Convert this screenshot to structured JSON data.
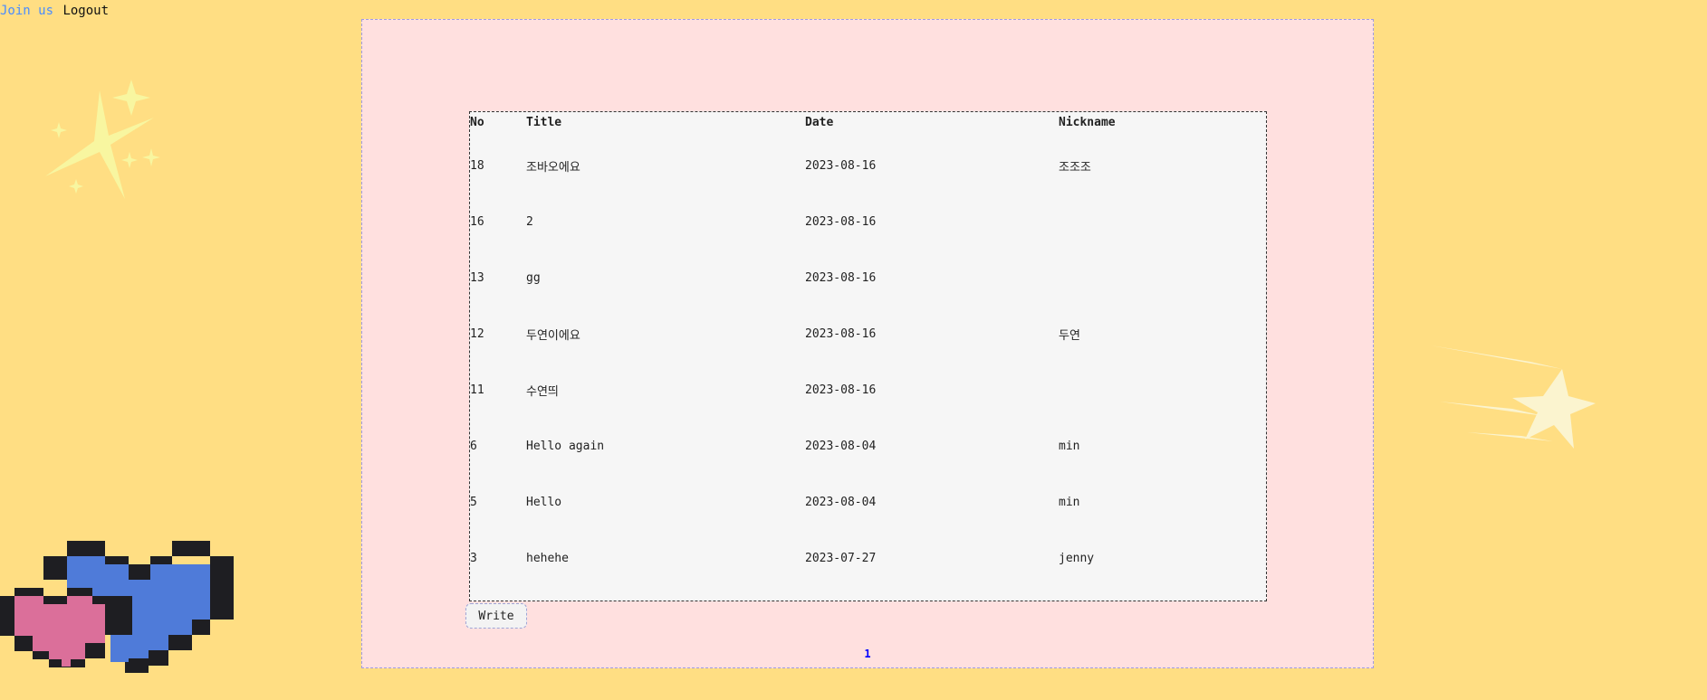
{
  "nav": {
    "join_label": "Join us",
    "logout_label": "Logout"
  },
  "table": {
    "headers": [
      "No",
      "Title",
      "Date",
      "Nickname"
    ],
    "rows": [
      {
        "no": "18",
        "title": "조바오에요",
        "date": "2023-08-16",
        "nickname": "조조조"
      },
      {
        "no": "16",
        "title": "2",
        "date": "2023-08-16",
        "nickname": ""
      },
      {
        "no": "13",
        "title": "gg",
        "date": "2023-08-16",
        "nickname": ""
      },
      {
        "no": "12",
        "title": "두연이에요",
        "date": "2023-08-16",
        "nickname": "두연"
      },
      {
        "no": "11",
        "title": "수연띄",
        "date": "2023-08-16",
        "nickname": ""
      },
      {
        "no": "6",
        "title": "Hello again",
        "date": "2023-08-04",
        "nickname": "min"
      },
      {
        "no": "5",
        "title": "Hello",
        "date": "2023-08-04",
        "nickname": "min"
      },
      {
        "no": "3",
        "title": "hehehe",
        "date": "2023-07-27",
        "nickname": "jenny"
      }
    ]
  },
  "write_label": "Write",
  "pagination": {
    "current": "1"
  },
  "decorations": {
    "sparkle": "sparkle-icon",
    "hearts": "pixel-hearts-icon",
    "shooting_star": "shooting-star-icon"
  },
  "colors": {
    "page_background": "#ffde83",
    "panel_background": "#ffe0df",
    "table_background": "#f6f6f6",
    "link_blue": "#4a8cff",
    "page_number": "#0000ff",
    "heart_pink": "#db6f9a",
    "heart_blue": "#4f7bd9"
  }
}
